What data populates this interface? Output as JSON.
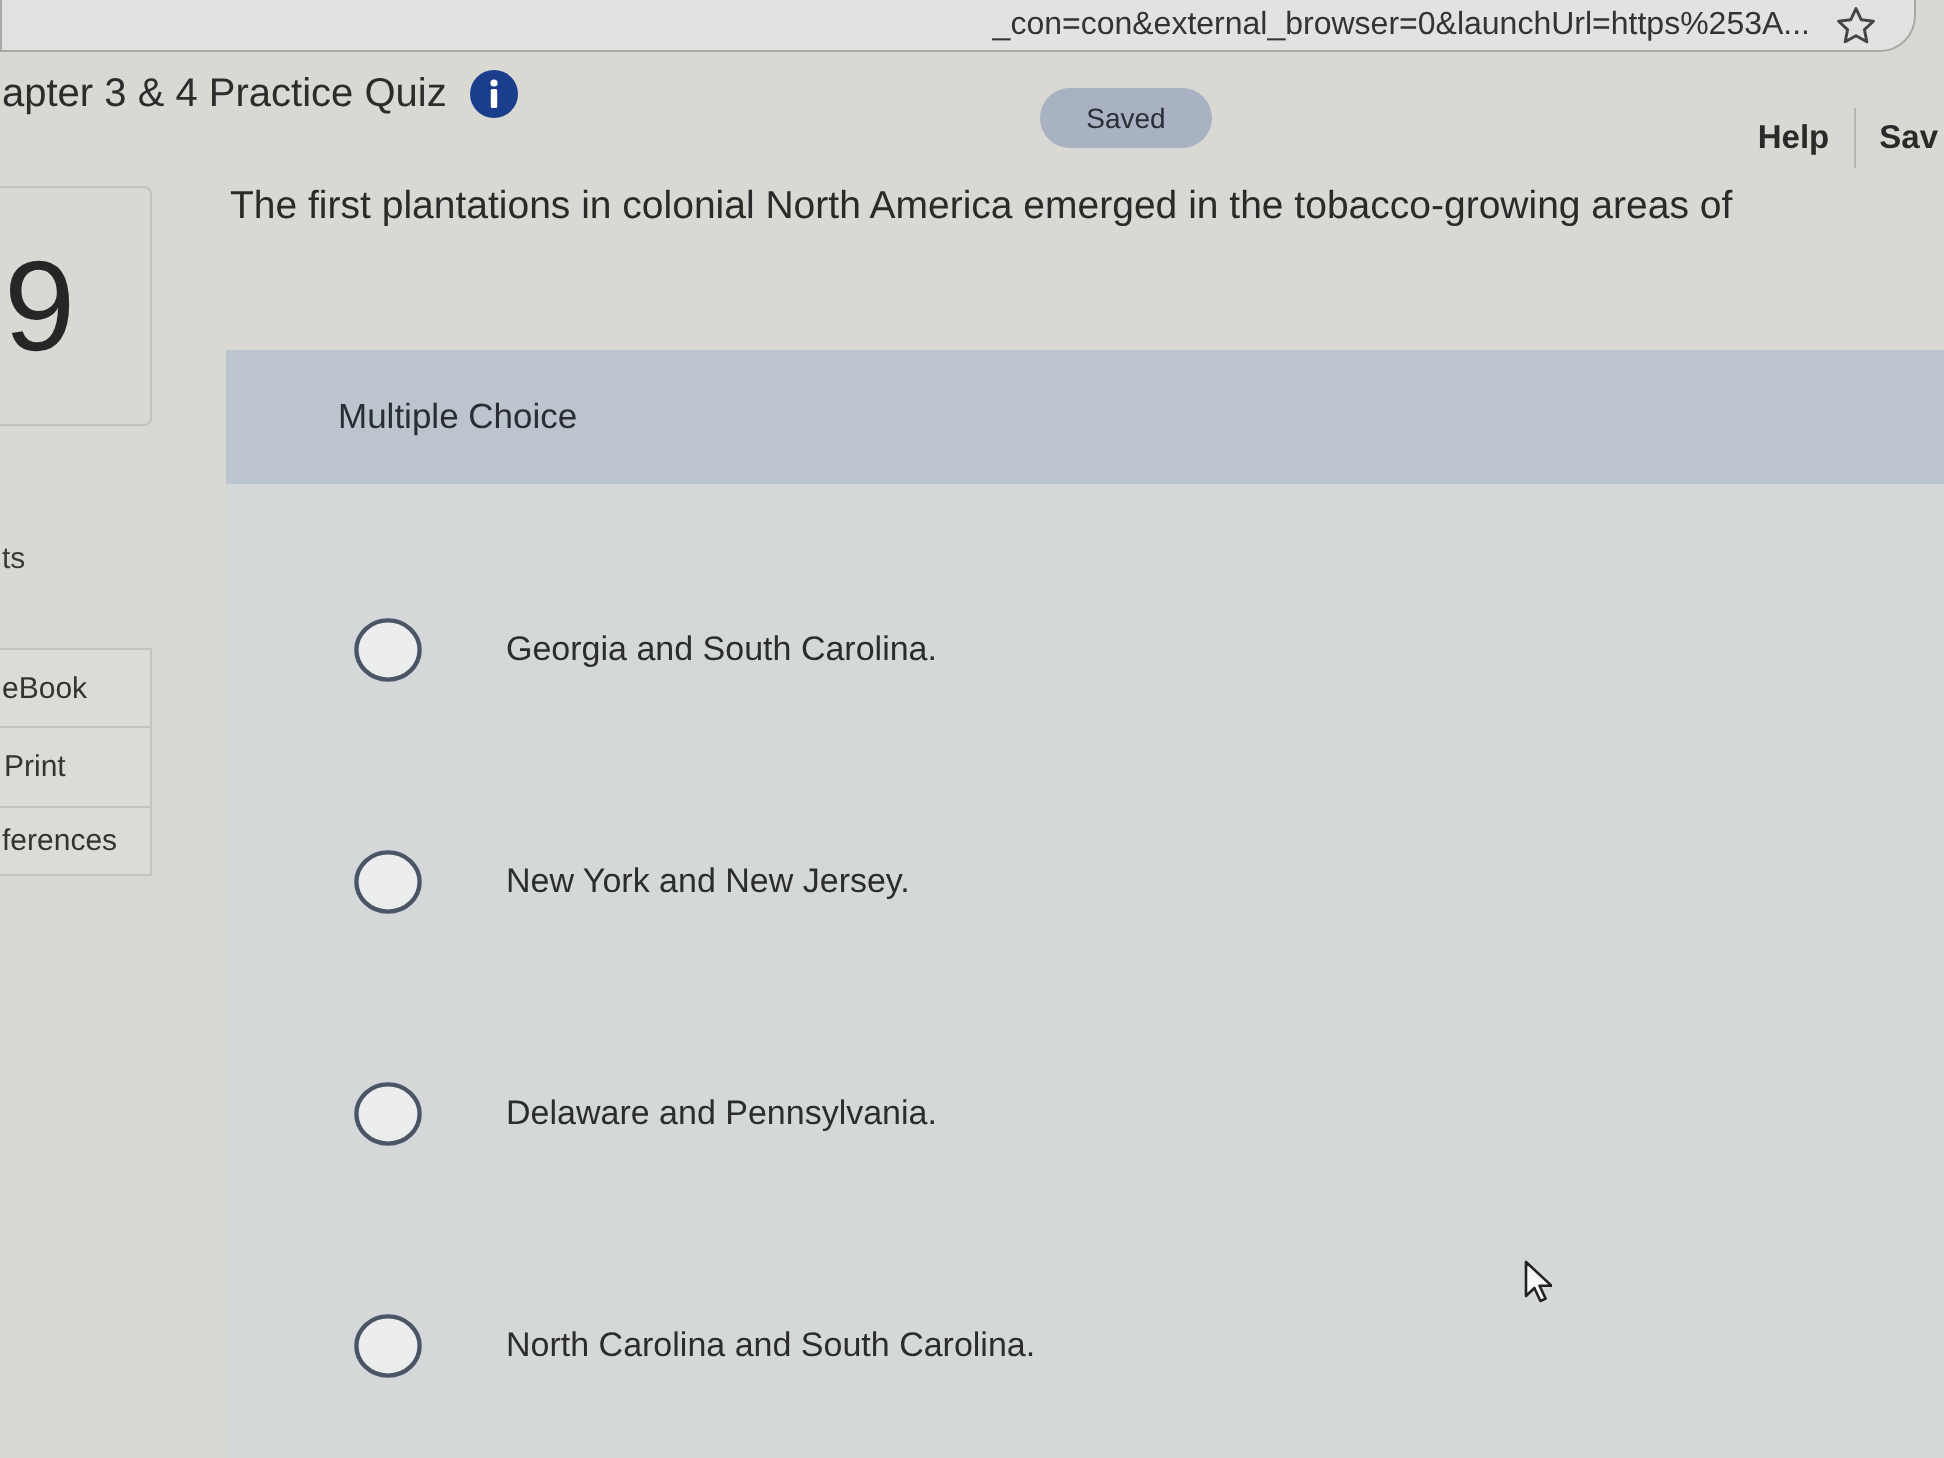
{
  "browser": {
    "address": "_con=con&external_browser=0&launchUrl=https%253A..."
  },
  "header": {
    "title": "apter 3 & 4 Practice Quiz",
    "status": "Saved",
    "links": [
      "Help",
      "Sav"
    ]
  },
  "sidebar": {
    "question_number": "9",
    "points_label": "ts",
    "tools": [
      "eBook",
      "Print",
      "ferences"
    ]
  },
  "question": {
    "text": "The first plantations in colonial North America emerged in the tobacco-growing areas of",
    "type_label": "Multiple Choice",
    "options": [
      {
        "label": "Georgia and South Carolina.",
        "selected": false
      },
      {
        "label": "New York and New Jersey.",
        "selected": false
      },
      {
        "label": "Delaware and Pennsylvania.",
        "selected": false
      },
      {
        "label": "North Carolina and South Carolina.",
        "selected": false
      }
    ]
  }
}
